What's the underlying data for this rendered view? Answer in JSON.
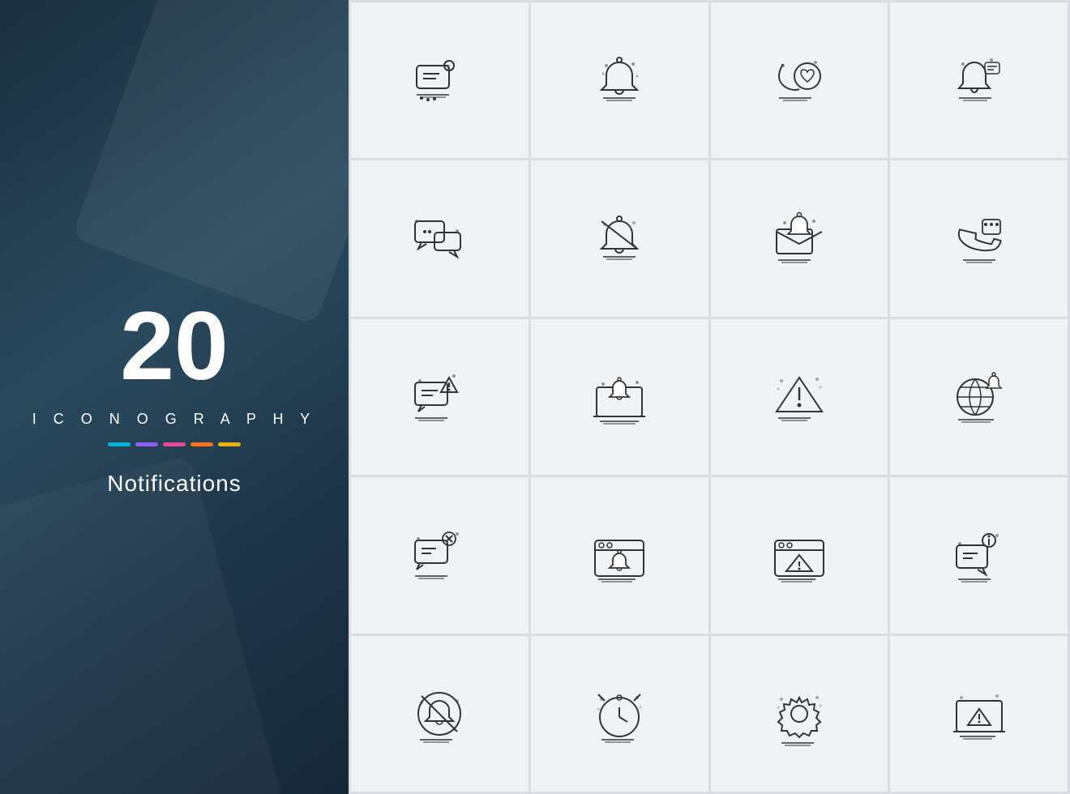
{
  "left": {
    "number": "20",
    "iconography": "I C O N O G R A P H Y",
    "title": "Notifications",
    "colors": [
      "#00b4d8",
      "#8b5cf6",
      "#ec4899",
      "#f97316",
      "#eab308"
    ]
  },
  "icons": [
    {
      "id": "chat-notification",
      "label": "Chat with notification badge"
    },
    {
      "id": "bell-notification",
      "label": "Bell notification"
    },
    {
      "id": "chat-heart",
      "label": "Chat with heart"
    },
    {
      "id": "bell-chat",
      "label": "Bell with chat bubble"
    },
    {
      "id": "chat-bubbles",
      "label": "Chat bubbles"
    },
    {
      "id": "bell-muted",
      "label": "Muted bell"
    },
    {
      "id": "email-bell",
      "label": "Email with bell"
    },
    {
      "id": "phone-chat",
      "label": "Phone with chat"
    },
    {
      "id": "chat-warning",
      "label": "Chat with warning"
    },
    {
      "id": "laptop-bell",
      "label": "Laptop with bell"
    },
    {
      "id": "warning-triangle",
      "label": "Warning triangle"
    },
    {
      "id": "globe-bell",
      "label": "Globe with bell"
    },
    {
      "id": "chat-close",
      "label": "Chat with close"
    },
    {
      "id": "browser-bell",
      "label": "Browser with bell"
    },
    {
      "id": "browser-warning",
      "label": "Browser with warning"
    },
    {
      "id": "chat-info",
      "label": "Chat with info"
    },
    {
      "id": "muted-bell-circle",
      "label": "Muted bell in circle"
    },
    {
      "id": "alarm-clock",
      "label": "Alarm clock"
    },
    {
      "id": "gear-settings",
      "label": "Gear settings"
    },
    {
      "id": "laptop-warning",
      "label": "Laptop with warning"
    }
  ]
}
